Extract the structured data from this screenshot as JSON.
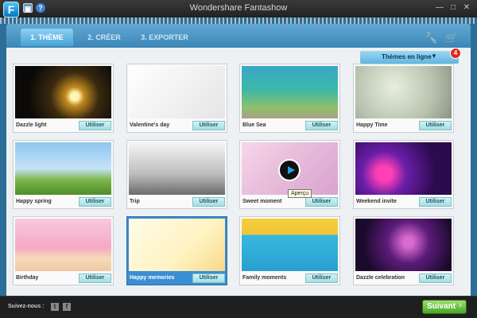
{
  "window": {
    "title": "Wondershare Fantashow",
    "logo_letter": "F"
  },
  "tabs": [
    {
      "label": "1. THÈME",
      "active": true
    },
    {
      "label": "2. CRÉER",
      "active": false
    },
    {
      "label": "3. EXPORTER",
      "active": false
    }
  ],
  "toolbar": {
    "icons": [
      "wrench-icon",
      "cart-icon"
    ]
  },
  "online_themes": {
    "label": "Thèmes en ligne",
    "badge": "4"
  },
  "cards": [
    {
      "title": "Dazzle light",
      "button": "Utiliser",
      "selected": false
    },
    {
      "title": "Valentine's day",
      "button": "Utiliser",
      "selected": false
    },
    {
      "title": "Blue Sea",
      "button": "Utiliser",
      "selected": false
    },
    {
      "title": "Happy Time",
      "button": "Utiliser",
      "selected": false
    },
    {
      "title": "Happy spring",
      "button": "Utiliser",
      "selected": false
    },
    {
      "title": "Trip",
      "button": "Utiliser",
      "selected": false
    },
    {
      "title": "Sweet moment",
      "button": "Utiliser",
      "selected": false
    },
    {
      "title": "Weekend invite",
      "button": "Utiliser",
      "selected": false
    },
    {
      "title": "Birthday",
      "button": "Utiliser",
      "selected": false
    },
    {
      "title": "Happy memories",
      "button": "Utiliser",
      "selected": true
    },
    {
      "title": "Family moments",
      "button": "Utiliser",
      "selected": false
    },
    {
      "title": "Dazzle celebration",
      "button": "Utiliser",
      "selected": false
    }
  ],
  "tooltip": "Aperçu",
  "footer": {
    "follow_label": "Suivez-nous :",
    "next_label": "Suivant"
  },
  "colors": {
    "accent": "#3a8ed3",
    "next_green": "#4aa42a",
    "badge_red": "#e0281c"
  }
}
